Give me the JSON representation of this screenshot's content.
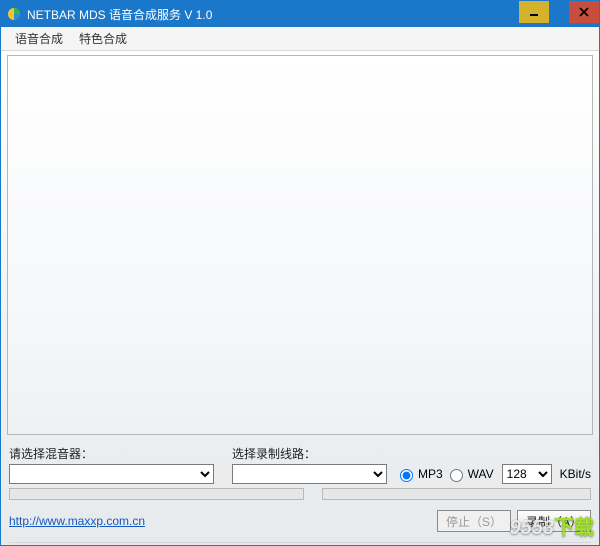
{
  "window": {
    "title": "NETBAR MDS 语音合成服务 V 1.0"
  },
  "menu": {
    "speech": "语音合成",
    "special": "特色合成"
  },
  "labels": {
    "mixer": "请选择混音器：",
    "line": "选择录制线路："
  },
  "radios": {
    "mp3": "MP3",
    "wav": "WAV"
  },
  "bitrate": {
    "value": "128",
    "unit": "KBit/s"
  },
  "link": {
    "text": "http://www.maxxp.com.cn"
  },
  "buttons": {
    "stop": "停止（S）",
    "record": "录制（A）"
  },
  "watermark": {
    "brand": "9553",
    "suffix": "下载"
  }
}
